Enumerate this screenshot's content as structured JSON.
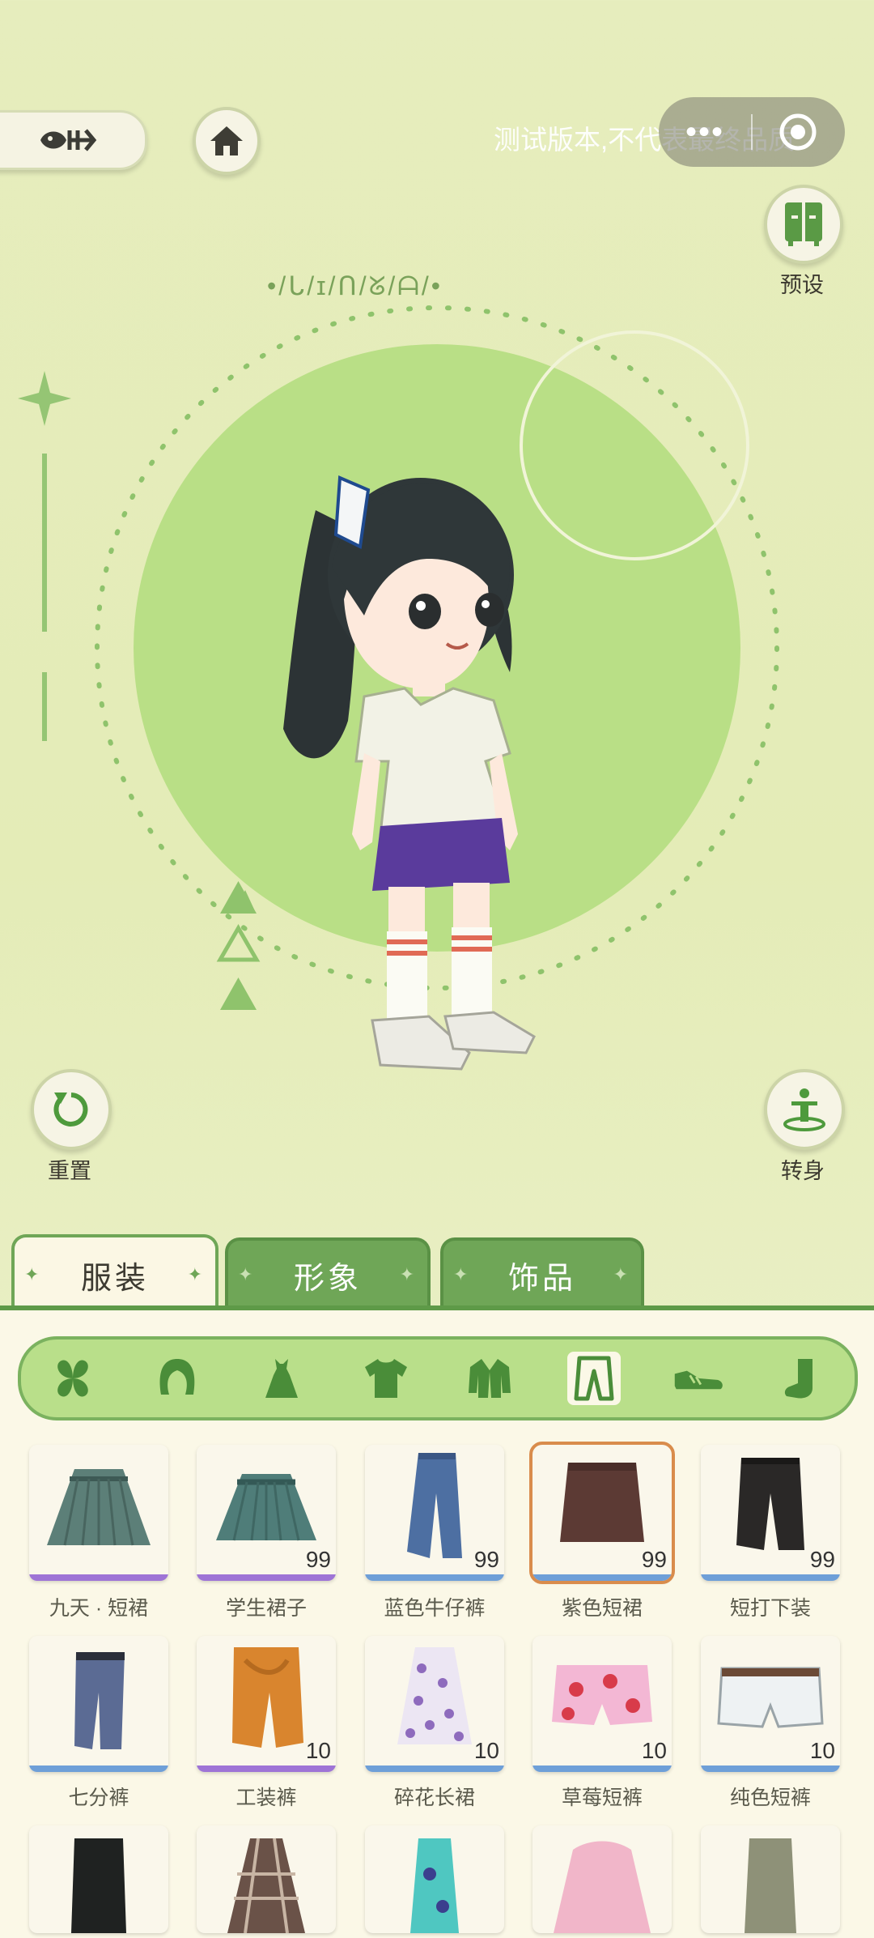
{
  "header": {
    "test_notice": "测试版本,不代表最终品质",
    "menu_dots": "•••"
  },
  "side_buttons": {
    "preset_label": "预设",
    "reset_label": "重置",
    "turn_label": "转身"
  },
  "decor_text": "•/ᒐ/ɪ/ᑎ/ᘜ/ᗩ/•",
  "tabs": [
    {
      "label": "服装",
      "active": true
    },
    {
      "label": "形象",
      "active": false
    },
    {
      "label": "饰品",
      "active": false
    }
  ],
  "categories": [
    "clover-icon",
    "hair-icon",
    "dress-icon",
    "shirt-icon",
    "jacket-icon",
    "pants-icon",
    "shoe-icon",
    "sock-icon"
  ],
  "items": [
    {
      "name": "九天 · 短裙",
      "count": "",
      "rarity_color": "#9e74d6"
    },
    {
      "name": "学生裙子",
      "count": "99",
      "rarity_color": "#9e74d6"
    },
    {
      "name": "蓝色牛仔裤",
      "count": "99",
      "rarity_color": "#6e9fd8"
    },
    {
      "name": "紫色短裙",
      "count": "99",
      "rarity_color": "#6e9fd8",
      "selected": true
    },
    {
      "name": "短打下装",
      "count": "99",
      "rarity_color": "#6e9fd8"
    },
    {
      "name": "七分裤",
      "count": "",
      "rarity_color": "#6e9fd8"
    },
    {
      "name": "工装裤",
      "count": "10",
      "rarity_color": "#9e74d6"
    },
    {
      "name": "碎花长裙",
      "count": "10",
      "rarity_color": "#6e9fd8"
    },
    {
      "name": "草莓短裤",
      "count": "10",
      "rarity_color": "#6e9fd8"
    },
    {
      "name": "纯色短裤",
      "count": "10",
      "rarity_color": "#6e9fd8"
    }
  ]
}
